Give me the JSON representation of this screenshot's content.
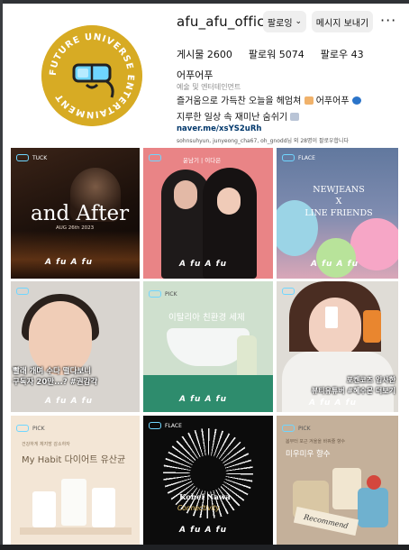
{
  "profile": {
    "username": "afu_afu_official",
    "follow_label": "팔로잉",
    "follow_chevron": "⌄",
    "message_label": "메시지 보내기",
    "more_label": "···",
    "stats": {
      "posts": "게시물 2600",
      "followers": "팔로워 5074",
      "following": "팔로우 43"
    },
    "display_name": "어푸어푸",
    "category": "예술 및 엔터테인먼트",
    "bio_line1": "즐거움으로 가득찬 오늘을 헤엄쳐",
    "bio_line1_end": "어푸어푸",
    "bio_line2": "지루한 일상 속 재미난 숨쉬기",
    "link": "naver.me/xsYS2uRh",
    "followed_by": "sohnsuhyun, junyeong_cha67, oh_gnodd님 외 28명이 팔로우합니다",
    "avatar": {
      "ring_text": "FUTURE UNIVERSE ENTERTAINMENT",
      "color": "#d7ab24"
    }
  },
  "posts": [
    {
      "tag": "TUCK",
      "title": "and After",
      "date": "AUG 26th 2023",
      "watermark": "A fu A fu"
    },
    {
      "label": "윤남기 | 이다은",
      "watermark": "A fu A fu"
    },
    {
      "tag": "FLACE",
      "line1": "NEWJEANS",
      "line2": "X",
      "line3": "LINE FRIENDS",
      "watermark": "A fu A fu"
    },
    {
      "tag": "",
      "caption1": "빨래 개며 수다 떨다보니",
      "caption2": "구독자 20만...? #권감각",
      "watermark": "A fu A fu"
    },
    {
      "tag": "PICK",
      "headline": "이탈리아 친환경 세제",
      "watermark": "A fu A fu"
    },
    {
      "tag": "",
      "caption1": "포켄코즈 입사한",
      "caption2": "뷰티유튜버 #혜수몬 더보기",
      "watermark": "A fu A fu"
    },
    {
      "tag": "PICK",
      "small": "건강하게 체지방 감소하자",
      "headline": "My Habit 다이어트 유산균"
    },
    {
      "tag": "FLACE",
      "title": "Kohei Nawa",
      "script": "Connectivity",
      "watermark": "A fu A fu"
    },
    {
      "tag": "PICK",
      "small": "봄부터 포근 겨울을 바꿔줄 향수",
      "headline": "미우미우 향수",
      "card": "Recommend"
    }
  ],
  "colors": {
    "button_bg": "#efefef",
    "link": "#00376b",
    "tag_glasses": "#6fd6ff"
  }
}
